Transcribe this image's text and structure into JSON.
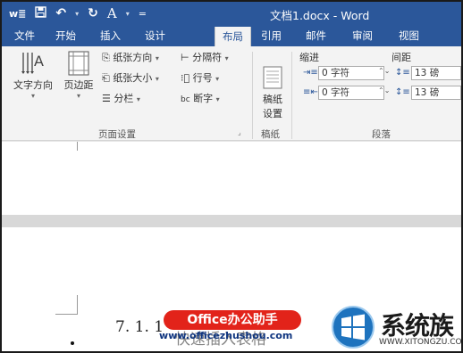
{
  "window": {
    "title": "文档1.docx - Word"
  },
  "qat": {
    "word_icon": "w≣",
    "save_icon": "save-icon",
    "undo": "↶",
    "redo": "↻",
    "font": "A",
    "more": "="
  },
  "tabs": [
    "文件",
    "开始",
    "插入",
    "设计",
    "布局",
    "引用",
    "邮件",
    "审阅",
    "视图"
  ],
  "active_tab": "布局",
  "ribbon": {
    "text_direction": "文字方向",
    "margins": "页边距",
    "orientation": "纸张方向",
    "size": "纸张大小",
    "columns": "分栏",
    "breaks": "分隔符",
    "line_numbers": "行号",
    "hyphenation": "断字",
    "page_setup_group": "页面设置",
    "draft_line1": "稿纸",
    "draft_line2": "设置",
    "draft_group": "稿纸",
    "indent_label": "缩进",
    "spacing_label": "间距",
    "indent_left": "0 字符",
    "indent_right": "0 字符",
    "space_before": "13 磅",
    "space_after": "13 磅",
    "paragraph_group": "段落"
  },
  "document": {
    "heading": "7. 1. 1",
    "heading_partial": "快速插入表格"
  },
  "watermarks": {
    "brand1": "Office办公助手",
    "brand1_url": "www.officezhushou.com",
    "brand2": "系统族",
    "brand2_url": "WWW.XITONGZU.COM"
  },
  "colors": {
    "accent": "#2b579a",
    "watermark_red": "#e2231a",
    "logo_blue": "#1e73be"
  }
}
